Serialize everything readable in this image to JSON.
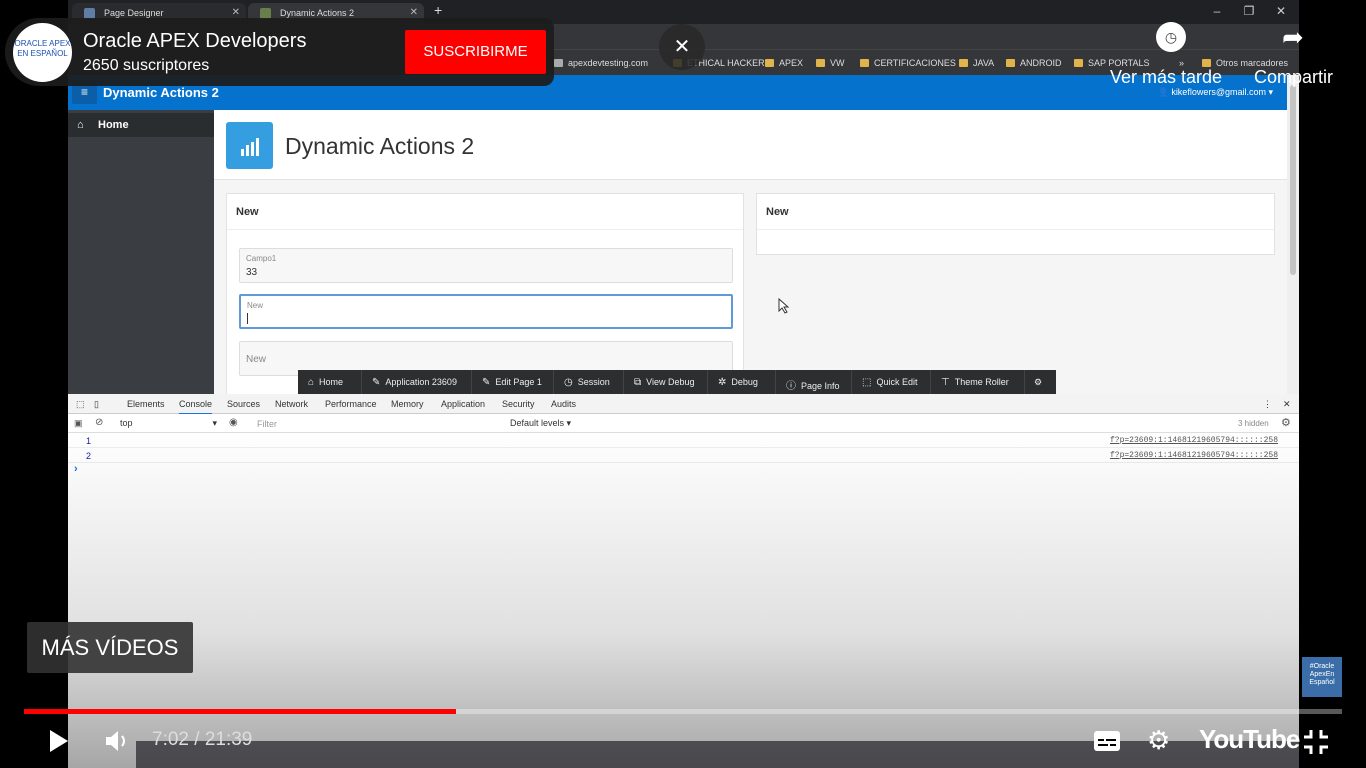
{
  "browser": {
    "tabs": [
      {
        "label": "Page Designer"
      },
      {
        "label": "Dynamic Actions 2"
      }
    ],
    "new_tab": "+",
    "bookmarks": [
      "apexdevtesting.com",
      "ETHICAL HACKER",
      "APEX",
      "VW",
      "CERTIFICACIONES",
      "JAVA",
      "ANDROID",
      "SAP PORTALS"
    ],
    "more_bookmarks": "»",
    "other_bookmarks": "Otros marcadores"
  },
  "apex": {
    "app_title": "Dynamic Actions 2",
    "user": "kikeflowers@gmail.com ▾",
    "nav_home": "Home",
    "page_title": "Dynamic Actions 2",
    "left_region_title": "New",
    "right_region_title": "New",
    "fields": [
      {
        "label": "Campo1",
        "value": "33"
      },
      {
        "label": "New",
        "value": ""
      },
      {
        "label": "",
        "placeholder": "New"
      }
    ]
  },
  "devbar": [
    "Home",
    "Application 23609",
    "Edit Page 1",
    "Session",
    "View Debug",
    "Debug",
    "Page Info",
    "Quick Edit",
    "Theme Roller"
  ],
  "devtools": {
    "tabs": [
      "Elements",
      "Console",
      "Sources",
      "Network",
      "Performance",
      "Memory",
      "Application",
      "Security",
      "Audits"
    ],
    "context": "top",
    "filter_placeholder": "Filter",
    "levels": "Default levels ▾",
    "hidden": "3 hidden",
    "logs": [
      {
        "n": "1",
        "src": "f?p=23609:1:14681219605794::::::258"
      },
      {
        "n": "2",
        "src": "f?p=23609:1:14681219605794::::::258"
      }
    ],
    "prompt": "›"
  },
  "youtube": {
    "channel_name": "Oracle APEX Developers",
    "channel_subs": "2650 suscriptores",
    "channel_logo": "ORACLE APEX EN ESPAÑOL",
    "subscribe": "SUSCRIBIRME",
    "watch_later": "Ver más tarde",
    "share": "Compartir",
    "more_videos": "MÁS VÍDEOS",
    "brand": "#Oracle ApexEn Español",
    "time": "7:02 / 21:39",
    "progress_fraction": 0.328,
    "logo": "YouTube"
  },
  "colors": {
    "apex_blue": "#0572ce",
    "subscribe_red": "#ff0000",
    "progress_red": "#ff0000"
  }
}
